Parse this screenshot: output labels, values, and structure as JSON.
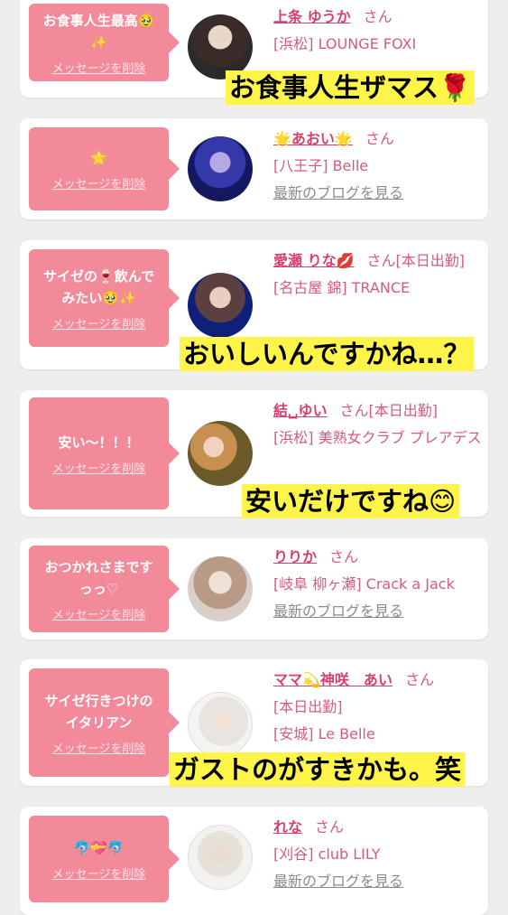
{
  "delete_label": "メッセージを削除",
  "san": "さん",
  "cards": [
    {
      "message": "お食事人生最高🥹\n✨",
      "name": "上条 ゆうか",
      "status": "",
      "shop": "[浜松] LOUNGE FOXI",
      "blog": "",
      "caption": "お食事人生ザマス🌹"
    },
    {
      "message": "🌟",
      "name": "🌟あおい🌟",
      "status": "",
      "shop": "[八王子] Belle",
      "blog": "最新のブログを見る",
      "caption": ""
    },
    {
      "message": "サイゼの🍷飲んで\nみたい🥹✨",
      "name": "愛瀬 りな💋",
      "status": "[本日出勤]",
      "shop": "[名古屋 錦] TRANCE",
      "blog": "",
      "caption": "おいしいんですかね…？"
    },
    {
      "message": "安い〜！！！",
      "name": "結␣ゆい",
      "status": "[本日出勤]",
      "shop": "[浜松] 美熟女クラブ プレアデス",
      "blog": "",
      "caption": "安いだけですね😊"
    },
    {
      "message": "おつかれさまです\nっっ♡",
      "name": "りりか",
      "status": "",
      "shop": "[岐阜 柳ヶ瀬] Crack a Jack",
      "blog": "最新のブログを見る",
      "caption": ""
    },
    {
      "message": "サイゼ行きつけの\nイタリアン",
      "name": "ママ💫神咲　あい",
      "status": "[本日出勤]",
      "shop": "[安城] Le Belle",
      "blog": "",
      "caption": "ガストのがすきかも。笑"
    },
    {
      "message": "🐬💝🐬",
      "name": "れな",
      "status": "",
      "shop": "[刈谷] club LILY",
      "blog": "最新のブログを見る",
      "caption": ""
    }
  ]
}
